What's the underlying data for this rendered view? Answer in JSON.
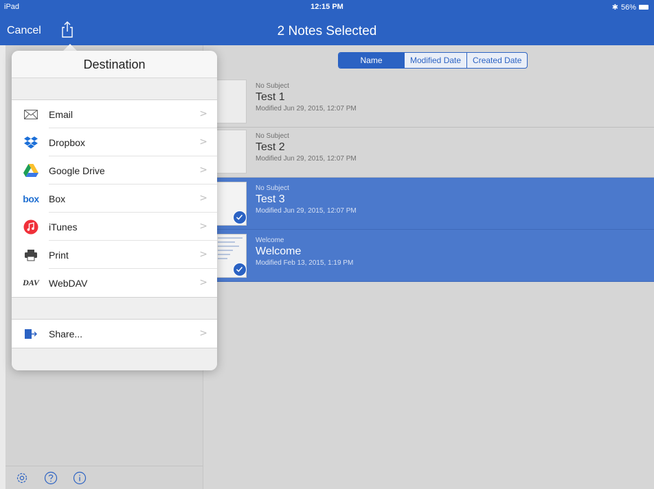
{
  "status": {
    "device": "iPad",
    "time": "12:15 PM",
    "battery": "56%"
  },
  "nav": {
    "cancel_label": "Cancel",
    "title": "2 Notes Selected"
  },
  "sort": {
    "options": [
      "Name",
      "Modified Date",
      "Created Date"
    ],
    "selected": "Name"
  },
  "notes": [
    {
      "subject": "No Subject",
      "title": "Test 1",
      "modified": "Modified Jun 29, 2015, 12:07 PM",
      "selected": false
    },
    {
      "subject": "No Subject",
      "title": "Test 2",
      "modified": "Modified Jun 29, 2015, 12:07 PM",
      "selected": false
    },
    {
      "subject": "No Subject",
      "title": "Test 3",
      "modified": "Modified Jun 29, 2015, 12:07 PM",
      "selected": true
    },
    {
      "subject": "Welcome",
      "title": "Welcome",
      "modified": "Modified Feb 13, 2015, 1:19 PM",
      "selected": true
    }
  ],
  "popover": {
    "title": "Destination",
    "destinations": [
      {
        "label": "Email",
        "icon": "envelope-icon"
      },
      {
        "label": "Dropbox",
        "icon": "dropbox-icon"
      },
      {
        "label": "Google Drive",
        "icon": "google-drive-icon"
      },
      {
        "label": "Box",
        "icon": "box-icon"
      },
      {
        "label": "iTunes",
        "icon": "itunes-icon"
      },
      {
        "label": "Print",
        "icon": "printer-icon"
      },
      {
        "label": "WebDAV",
        "icon": "webdav-icon"
      }
    ],
    "share_label": "Share...",
    "chevron": ">"
  },
  "icons": {
    "box_text": "box",
    "dav_text": "DAV"
  },
  "colors": {
    "accent": "#2b62c3",
    "selected_row": "#4b79cc",
    "itunes": "#f0303a",
    "dropbox": "#1d70d8"
  }
}
